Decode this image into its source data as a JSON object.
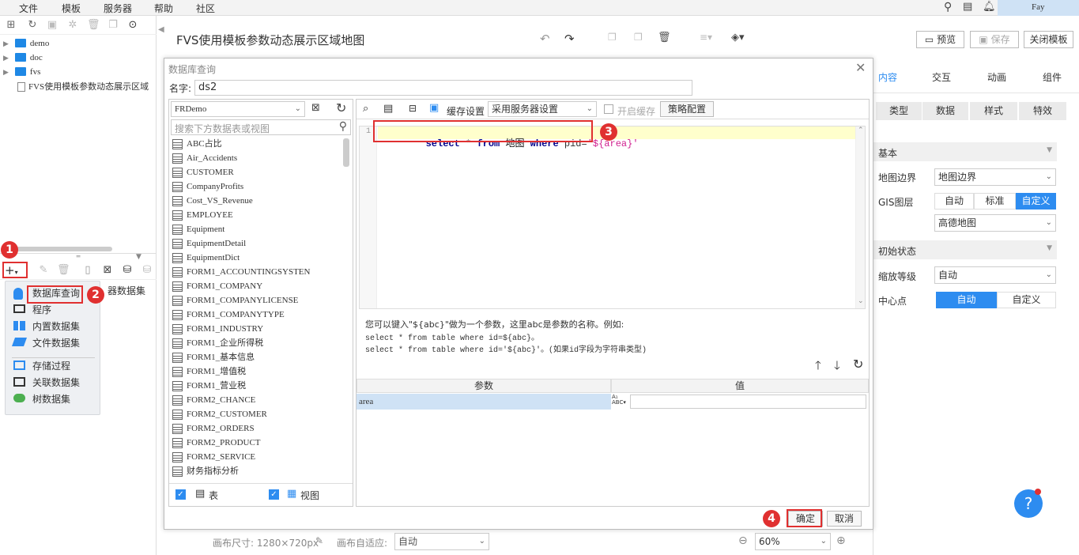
{
  "menubar": {
    "items": [
      "文件",
      "模板",
      "服务器",
      "帮助",
      "社区"
    ],
    "user": "Fay"
  },
  "left_tree": {
    "items": [
      "demo",
      "doc",
      "fvs",
      "FVS使用模板参数动态展示区域"
    ]
  },
  "add_menu": {
    "items": [
      "数据库查询",
      "程序",
      "内置数据集",
      "文件数据集",
      "存储过程",
      "关联数据集",
      "树数据集"
    ],
    "bg_label": "器数据集"
  },
  "header": {
    "title": "FVS使用模板参数动态展示区域地图",
    "preview": "预览",
    "save": "保存",
    "close": "关闭模板"
  },
  "dialog": {
    "title": "数据库查询",
    "name_label": "名字:",
    "name_value": "ds2",
    "connection": "FRDemo",
    "search_placeholder": "搜索下方数据表或视图",
    "tables": [
      "ABC占比",
      "Air_Accidents",
      "CUSTOMER",
      "CompanyProfits",
      "Cost_VS_Revenue",
      "EMPLOYEE",
      "Equipment",
      "EquipmentDetail",
      "EquipmentDict",
      "FORM1_ACCOUNTINGSYSTEN",
      "FORM1_COMPANY",
      "FORM1_COMPANYLICENSE",
      "FORM1_COMPANYTYPE",
      "FORM1_INDUSTRY",
      "FORM1_企业所得税",
      "FORM1_基本信息",
      "FORM1_增值税",
      "FORM1_营业税",
      "FORM2_CHANCE",
      "FORM2_CUSTOMER",
      "FORM2_ORDERS",
      "FORM2_PRODUCT",
      "FORM2_SERVICE",
      "财务指标分析"
    ],
    "check_table": "表",
    "check_view": "视图",
    "cache_label": "缓存设置",
    "cache_select": "采用服务器设置",
    "enable_cache": "开启缓存",
    "strategy": "策略配置",
    "sql": {
      "line": "1",
      "kw1": "select",
      "star": "*",
      "kw2": "from",
      "table": "地图",
      "kw3": "where",
      "field": "pid=",
      "str": "'${area}'"
    },
    "hint": [
      "您可以键入\"${abc}\"做为一个参数，这里abc是参数的名称。例如:",
      "select * from table where id=${abc}。",
      "select * from table where id='${abc}'。(如果id字段为字符串类型)"
    ],
    "param_header": "参数",
    "value_header": "值",
    "param_name": "area",
    "ok": "确定",
    "cancel": "取消"
  },
  "badges": [
    "1",
    "2",
    "3",
    "4"
  ],
  "right_panel": {
    "tabs": [
      "内容",
      "交互",
      "动画",
      "组件"
    ],
    "subtabs": [
      "类型",
      "数据",
      "样式",
      "特效"
    ],
    "section_basic": "基本",
    "map_border_label": "地图边界",
    "map_border_value": "地图边界",
    "gis_label": "GIS图层",
    "gis_options": [
      "自动",
      "标准",
      "自定义"
    ],
    "gis_map": "高德地图",
    "section_init": "初始状态",
    "zoom_label": "缩放等级",
    "zoom_value": "自动",
    "center_label": "中心点",
    "center_options": [
      "自动",
      "自定义"
    ]
  },
  "bottom": {
    "canvas_size": "画布尺寸: 1280×720px",
    "autofit_label": "画布自适应:",
    "autofit_value": "自动",
    "zoom": "60%"
  },
  "colors": {
    "accent": "#2d8cf0",
    "red": "#e03030",
    "sql_highlight": "#ffffcc"
  }
}
